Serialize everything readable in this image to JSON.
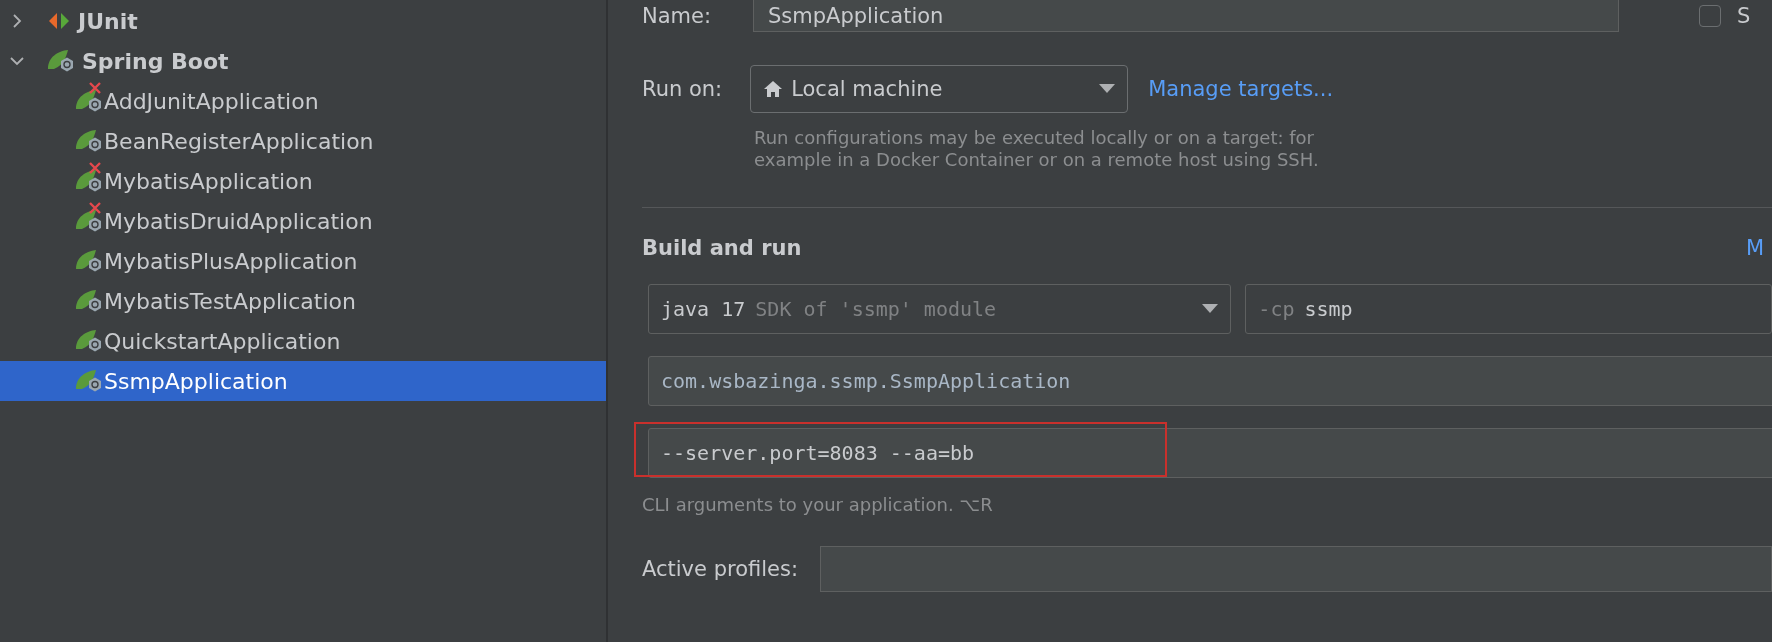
{
  "tree": [
    {
      "label": "JUnit",
      "kind": "junit",
      "expanded": false,
      "selected": false
    },
    {
      "label": "Spring Boot",
      "kind": "spring",
      "expanded": true,
      "selected": false,
      "children": [
        {
          "label": "AddJunitApplication",
          "error": true,
          "selected": false
        },
        {
          "label": "BeanRegisterApplication",
          "error": false,
          "selected": false
        },
        {
          "label": "MybatisApplication",
          "error": true,
          "selected": false
        },
        {
          "label": "MybatisDruidApplication",
          "error": true,
          "selected": false
        },
        {
          "label": "MybatisPlusApplication",
          "error": false,
          "selected": false
        },
        {
          "label": "MybatisTestApplication",
          "error": false,
          "selected": false
        },
        {
          "label": "QuickstartApplication",
          "error": false,
          "selected": false
        },
        {
          "label": "SsmpApplication",
          "error": false,
          "selected": true
        }
      ]
    }
  ],
  "form": {
    "name_label": "Name:",
    "name_value": "SsmpApplication",
    "store_checkbox": {
      "label": "S",
      "checked": false
    },
    "run_on_label": "Run on:",
    "run_on_value": "Local machine",
    "manage_link": "Manage targets...",
    "run_on_hint": "Run configurations may be executed locally or on a target: for example in a Docker Container or on a remote host using SSH.",
    "section_title": "Build and run",
    "modify_link": "M",
    "jdk_value": "java 17",
    "jdk_hint": "SDK of 'ssmp' module",
    "cp_flag": "-cp",
    "cp_value": "ssmp",
    "main_class": "com.wsbazinga.ssmp.SsmpApplication",
    "program_args": "--server.port=8083 --aa=bb",
    "args_highlighted": true,
    "args_hint": "CLI arguments to your application. ⌥R",
    "profiles_label": "Active profiles:"
  }
}
